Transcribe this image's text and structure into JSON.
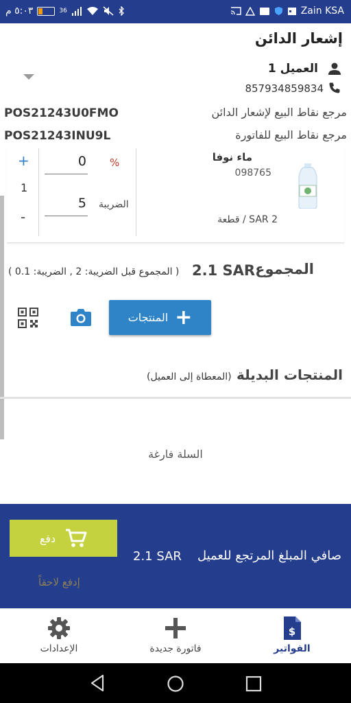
{
  "status_bar": {
    "time": "٥:٠٣ م",
    "carrier": "Zain KSA",
    "network": "36",
    "battery_level": 0.25,
    "battery_color": "#f39c12"
  },
  "header": {
    "title": "إشعار الدائن",
    "customer_name": "العميل 1",
    "customer_phone": "857934859834"
  },
  "references": [
    {
      "label": "مرجع نقاط البيع لإشعار الدائن",
      "value": "POS21243U0FMO"
    },
    {
      "label": "مرجع نقاط البيع للفاتورة",
      "value": "POS21243INU9L"
    }
  ],
  "product": {
    "name": "ماء نوفا",
    "code": "098765",
    "price": "2 SAR / قطعة",
    "quantity": "1",
    "discount_value": "0",
    "discount_symbol": "%",
    "tax_label": "الضريبة",
    "tax_value": "5",
    "increment_label": "+",
    "decrement_label": "-"
  },
  "totals": {
    "label": "المجموع",
    "value": "2.1 SAR",
    "breakdown": "( المجموع قبل الضريبة: 2 , الضريبة: 0.1 )"
  },
  "actions": {
    "add_products_label": "المنتجات",
    "add_products_icon": "+"
  },
  "alternative_products": {
    "title": "المنتجات البديلة",
    "subtitle": "(المعطاة إلى العميل)",
    "empty_text": "السلة فارغة"
  },
  "payment": {
    "pay_label": "دفع",
    "net_label": "صافي المبلغ المرتجع للعميل",
    "net_amount": "2.1 SAR",
    "pay_later_label": "إدفع لاحقاً"
  },
  "bottom_nav": {
    "invoices": "الفواتير",
    "new_invoice": "فاتورة جديدة",
    "settings": "الإعدادات"
  },
  "colors": {
    "primary": "#243d8c",
    "button_blue": "#2f84c8",
    "pay_button": "#c3d23e"
  }
}
